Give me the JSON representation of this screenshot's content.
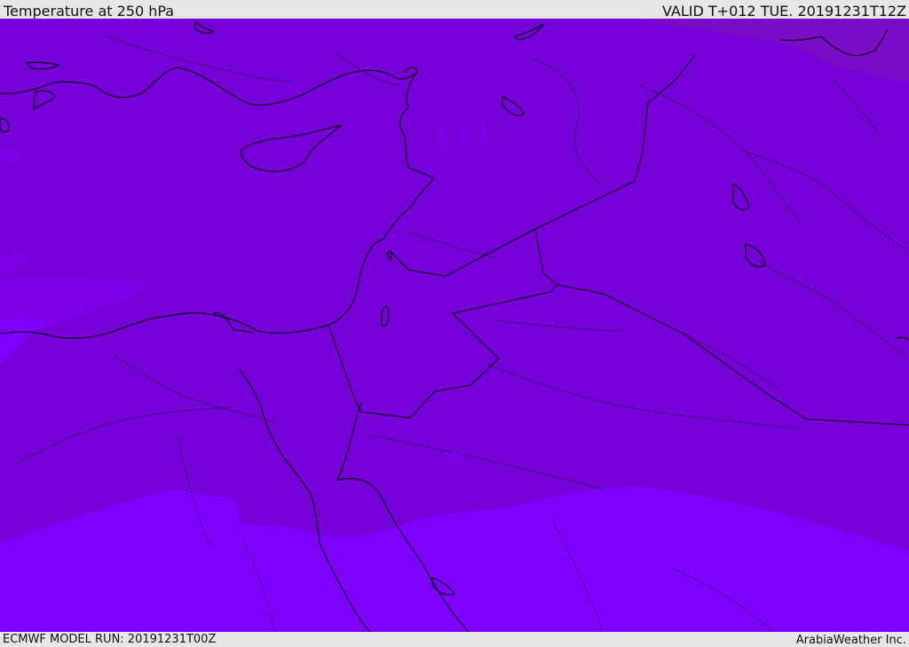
{
  "header": {
    "title": "Temperature at 250 hPa",
    "valid_time": "VALID T+012 TUE. 20191231T12Z"
  },
  "footer": {
    "model_run": "ECMWF MODEL RUN: 20191231T00Z",
    "credit": "ArabiaWeather Inc."
  },
  "map": {
    "colors": {
      "band_main": "#7600d8",
      "band_cold": "#7e00ff",
      "band_light": "#7d00e8",
      "band_warm": "#7a0cc8",
      "coastline": "#000000",
      "border": "#000000"
    }
  }
}
